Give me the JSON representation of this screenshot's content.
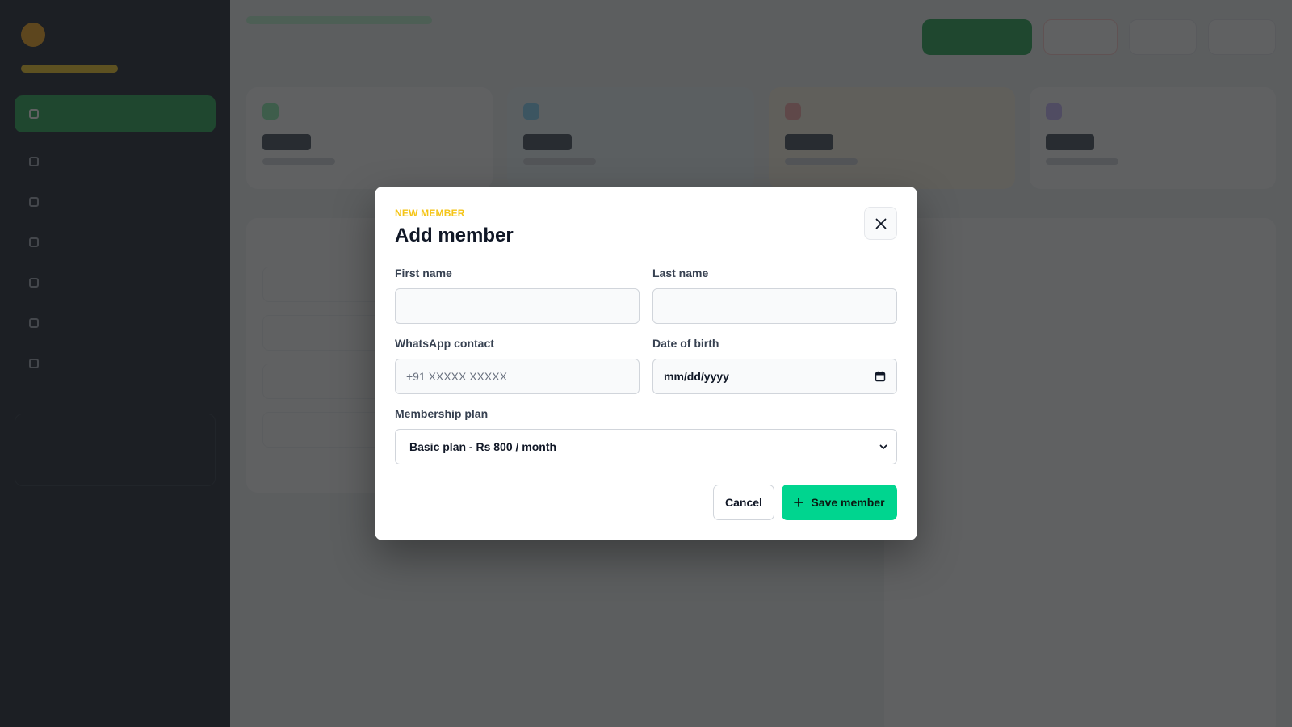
{
  "modal": {
    "eyebrow": "NEW MEMBER",
    "title": "Add member",
    "fields": {
      "first_name": {
        "label": "First name",
        "value": "",
        "placeholder": ""
      },
      "last_name": {
        "label": "Last name",
        "value": "",
        "placeholder": ""
      },
      "whatsapp": {
        "label": "WhatsApp contact",
        "value": "",
        "placeholder": "+91 XXXXX XXXXX"
      },
      "dob": {
        "label": "Date of birth",
        "value": "mm/dd/yyyy"
      },
      "plan": {
        "label": "Membership plan",
        "selected": "Basic plan - Rs 800 / month"
      }
    },
    "cancel_label": "Cancel",
    "save_label": "Save member"
  },
  "colors": {
    "accent": "#00d58f",
    "eyebrow": "#f5c518",
    "sidebar": "#0b1220",
    "overlay": "rgba(35,36,38,0.72)"
  },
  "icons": {
    "close": "close-icon",
    "calendar": "calendar-icon",
    "select": "chevron-down-icon",
    "save": "plus-icon"
  }
}
